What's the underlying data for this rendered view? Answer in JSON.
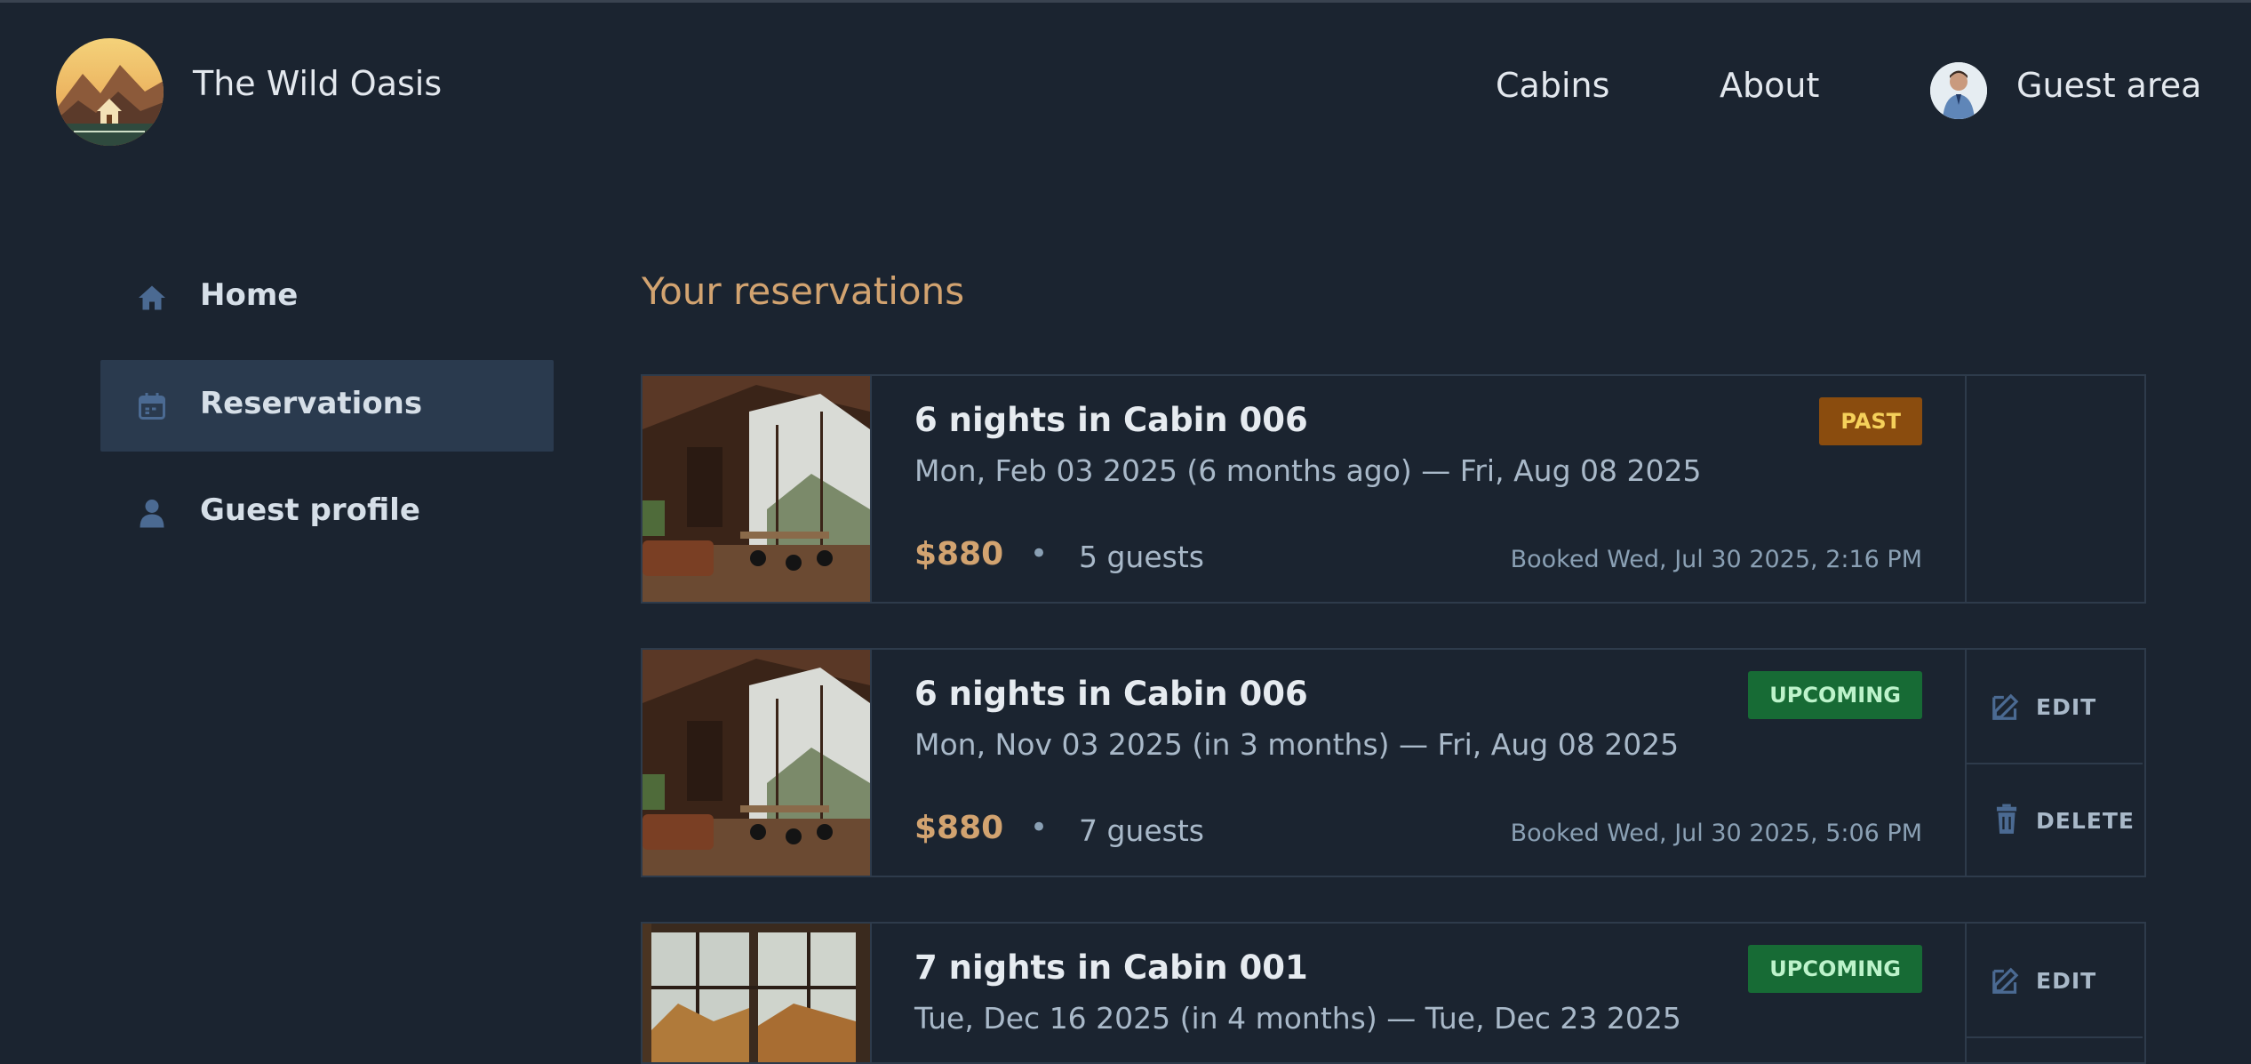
{
  "header": {
    "brand": "The Wild Oasis",
    "nav": {
      "cabins": "Cabins",
      "about": "About",
      "guest_area": "Guest area"
    }
  },
  "sidebar": {
    "items": [
      {
        "label": "Home",
        "icon": "home-icon"
      },
      {
        "label": "Reservations",
        "icon": "calendar-icon",
        "active": true
      },
      {
        "label": "Guest profile",
        "icon": "user-icon"
      }
    ]
  },
  "main": {
    "title": "Your reservations",
    "reservations": [
      {
        "title": "6 nights in Cabin 006",
        "dates": "Mon, Feb 03 2025 (6 months ago) — Fri, Aug 08 2025",
        "price": "$880",
        "dot": "•",
        "guests": "5 guests",
        "booked": "Booked Wed, Jul 30 2025, 2:16 PM",
        "status": "PAST"
      },
      {
        "title": "6 nights in Cabin 006",
        "dates": "Mon, Nov 03 2025 (in 3 months) — Fri, Aug 08 2025",
        "price": "$880",
        "dot": "•",
        "guests": "7 guests",
        "booked": "Booked Wed, Jul 30 2025, 5:06 PM",
        "status": "UPCOMING",
        "edit": "EDIT",
        "delete": "DELETE"
      },
      {
        "title": "7 nights in Cabin 001",
        "dates": "Tue, Dec 16 2025 (in 4 months) — Tue, Dec 23 2025",
        "status": "UPCOMING",
        "edit": "EDIT"
      }
    ]
  },
  "colors": {
    "background": "#1b2430",
    "accent": "#d2a370",
    "past_badge": "#8a4c0e",
    "upcoming_badge": "#176b35",
    "active_sidebar": "#2a3a4e"
  }
}
